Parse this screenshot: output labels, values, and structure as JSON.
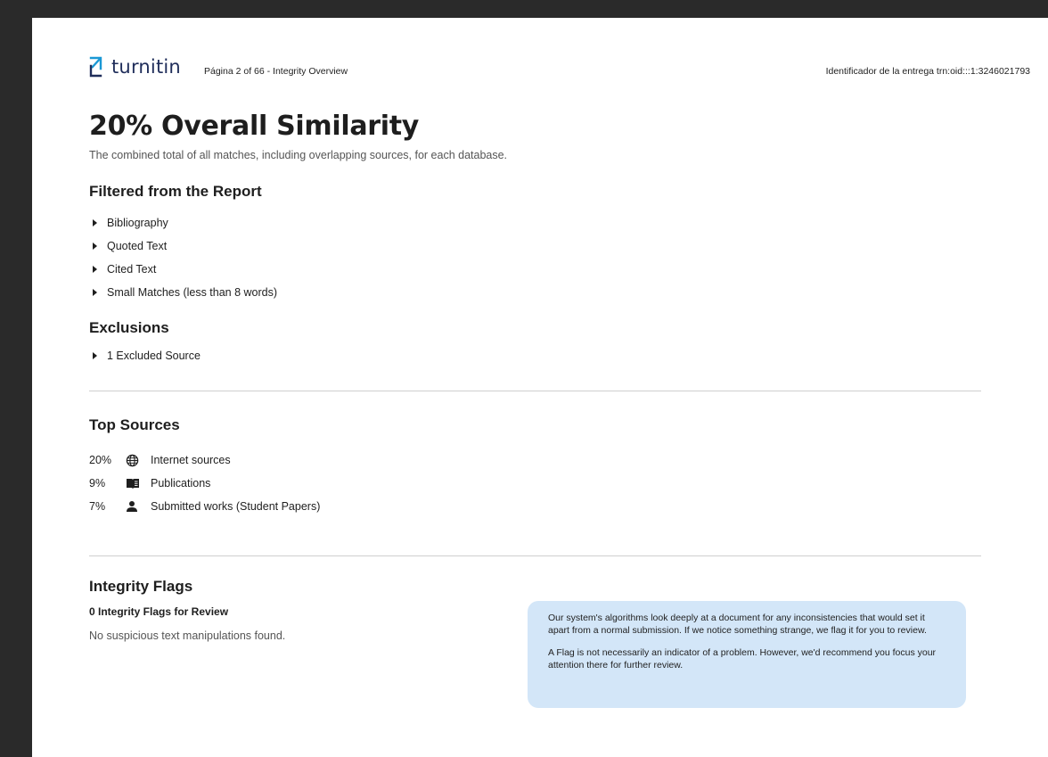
{
  "header": {
    "brand": "turnitin",
    "page_info": "Página 2 of 66 - Integrity Overview",
    "submission_id": "Identificador de la entrega trn:oid:::1:3246021793"
  },
  "similarity": {
    "title": "20% Overall Similarity",
    "subtitle": "The combined total of all matches, including overlapping sources, for each database."
  },
  "filtered": {
    "heading": "Filtered from the Report",
    "items": [
      "Bibliography",
      "Quoted Text",
      "Cited Text",
      "Small Matches (less than 8 words)"
    ]
  },
  "exclusions": {
    "heading": "Exclusions",
    "items": [
      "1 Excluded Source"
    ]
  },
  "top_sources": {
    "heading": "Top Sources",
    "items": [
      {
        "pct": "20%",
        "icon": "globe-icon",
        "label": "Internet sources"
      },
      {
        "pct": "9%",
        "icon": "book-icon",
        "label": "Publications"
      },
      {
        "pct": "7%",
        "icon": "person-icon",
        "label": "Submitted works (Student Papers)"
      }
    ]
  },
  "integrity": {
    "heading": "Integrity Flags",
    "count": "0 Integrity Flags for Review",
    "status": "No suspicious text manipulations found.",
    "info_p1": "Our system's algorithms look deeply at a document for any inconsistencies that would set it apart from a normal submission. If we notice something strange, we flag it for you to review.",
    "info_p2": "A Flag is not necessarily an indicator of a problem. However, we'd recommend you focus your attention there for further review."
  },
  "colors": {
    "brand": "#1a98d5",
    "info_box": "#d3e6f8"
  }
}
